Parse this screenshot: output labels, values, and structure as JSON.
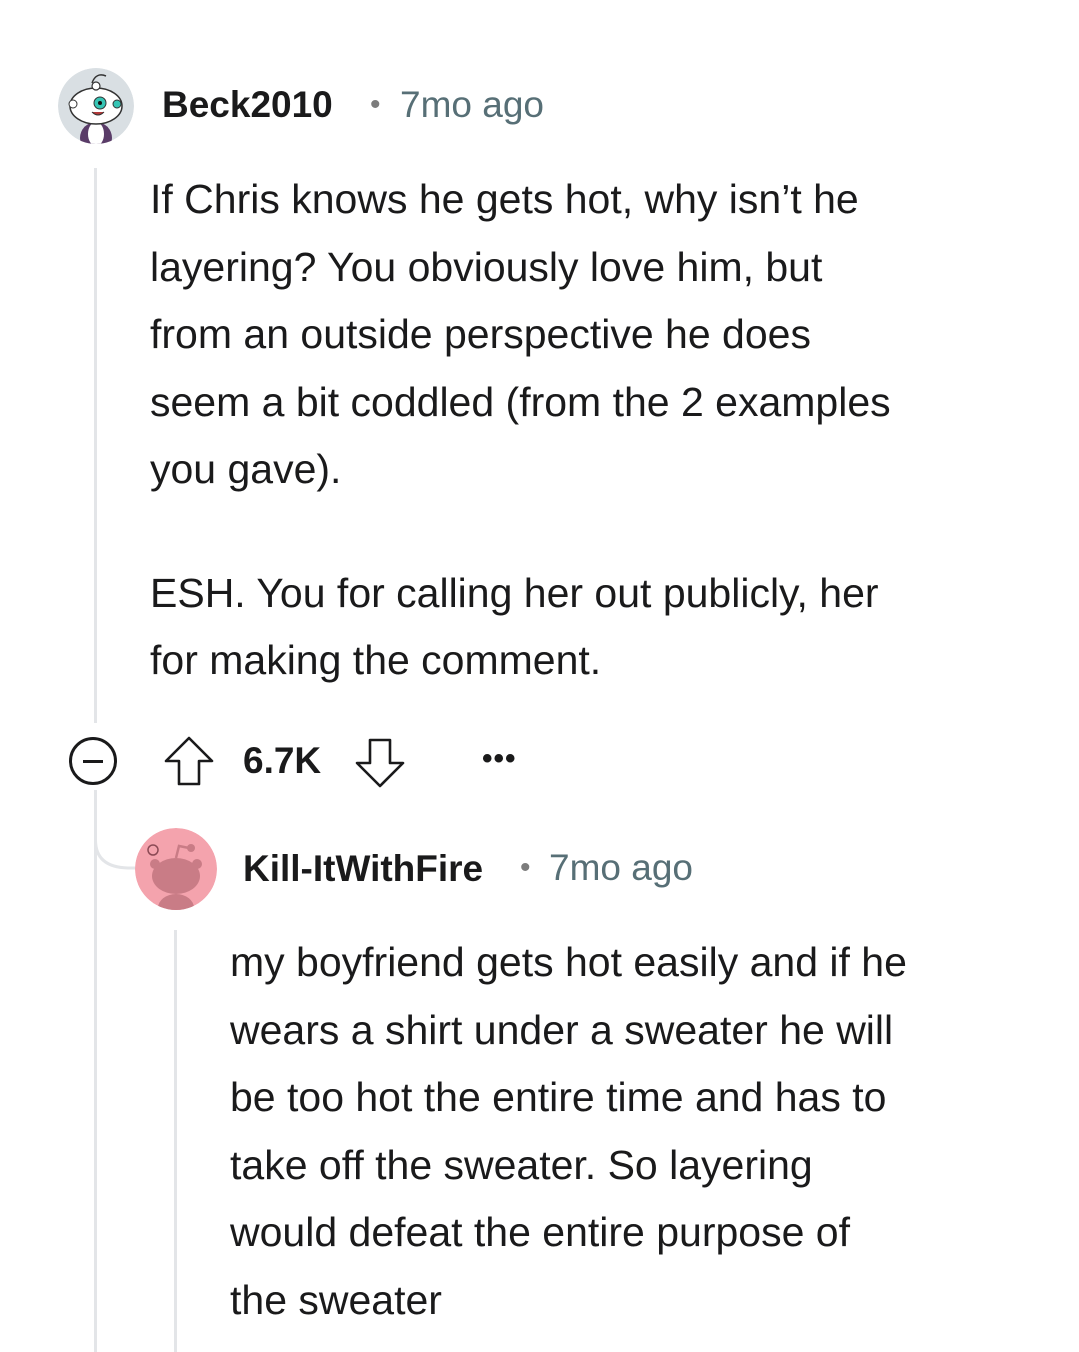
{
  "comment": {
    "username": "Beck2010",
    "separator": "•",
    "timestamp": "7mo ago",
    "body_paragraphs": [
      "If Chris knows he gets hot, why isn’t he\nlayering? You obviously love him, but\nfrom an outside perspective he does\nseem a bit coddled (from the 2 examples\nyou gave).",
      "ESH. You for calling her out publicly, her\nfor making the comment."
    ],
    "vote_count": "6.7K",
    "more_label": "•••"
  },
  "reply": {
    "username": "Kill-ItWithFire",
    "separator": "•",
    "timestamp": "7mo ago",
    "body": "my boyfriend gets hot easily and if he\nwears a shirt under a sweater he will\nbe too hot the entire time and has to\ntake off the sweater. So layering\nwould defeat the entire purpose of\nthe sweater"
  },
  "icons": {
    "collapse": "collapse-icon",
    "upvote": "upvote-arrow-icon",
    "downvote": "downvote-arrow-icon",
    "more": "more-options-icon",
    "avatar_main": "snoo-avatar-icon",
    "avatar_reply": "default-snoo-avatar-icon"
  },
  "colors": {
    "reply_avatar_bg": "#f4a3ad",
    "reply_avatar_snoo": "#c97c86",
    "timestamp": "#576f76"
  }
}
